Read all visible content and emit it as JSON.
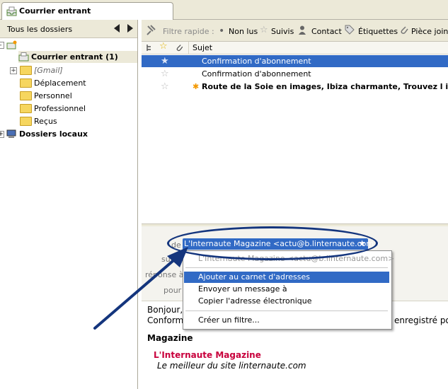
{
  "tab": {
    "label": "Courrier entrant"
  },
  "folders": {
    "header": "Tous les dossiers",
    "inbox": "Courrier entrant (1)",
    "gmail": "[Gmail]",
    "items": [
      "Déplacement",
      "Personnel",
      "Professionnel",
      "Reçus"
    ],
    "local": "Dossiers locaux"
  },
  "filter": {
    "label": "Filtre rapide :",
    "unread": "Non lus",
    "starred": "Suivis",
    "contact": "Contact",
    "tags": "Étiquettes",
    "attach": "Pièce jointe"
  },
  "list": {
    "subject_header": "Sujet",
    "messages": [
      {
        "subject": "Confirmation d'abonnement"
      },
      {
        "subject": "Confirmation d'abonnement"
      },
      {
        "subject": "Route de la Soie en images, Ibiza charmante, Trouvez l intrus, Les ..."
      }
    ]
  },
  "header": {
    "de": "de",
    "sujet": "sujet",
    "reply": "réponse à",
    "pour": "pour",
    "from": "L'Internaute Magazine <actu@b.linternaute.com>"
  },
  "menu": {
    "address": "L'Internaute Magazine <actu@b.linternaute.com>",
    "add": "Ajouter au carnet d'adresses",
    "send": "Envoyer un message à",
    "copy": "Copier l'adresse électronique",
    "filter": "Créer un filtre..."
  },
  "body": {
    "hello": "Bonjour,",
    "confirm_start": "Conform",
    "confirm_end": "enregistré pour",
    "magazine": "Magazine",
    "brand": "L'Internaute Magazine",
    "tagline": "Le meilleur du site linternaute.com"
  },
  "colors": {
    "selection": "#316ac5",
    "brand": "#c8003c",
    "arrow": "#14357d"
  }
}
